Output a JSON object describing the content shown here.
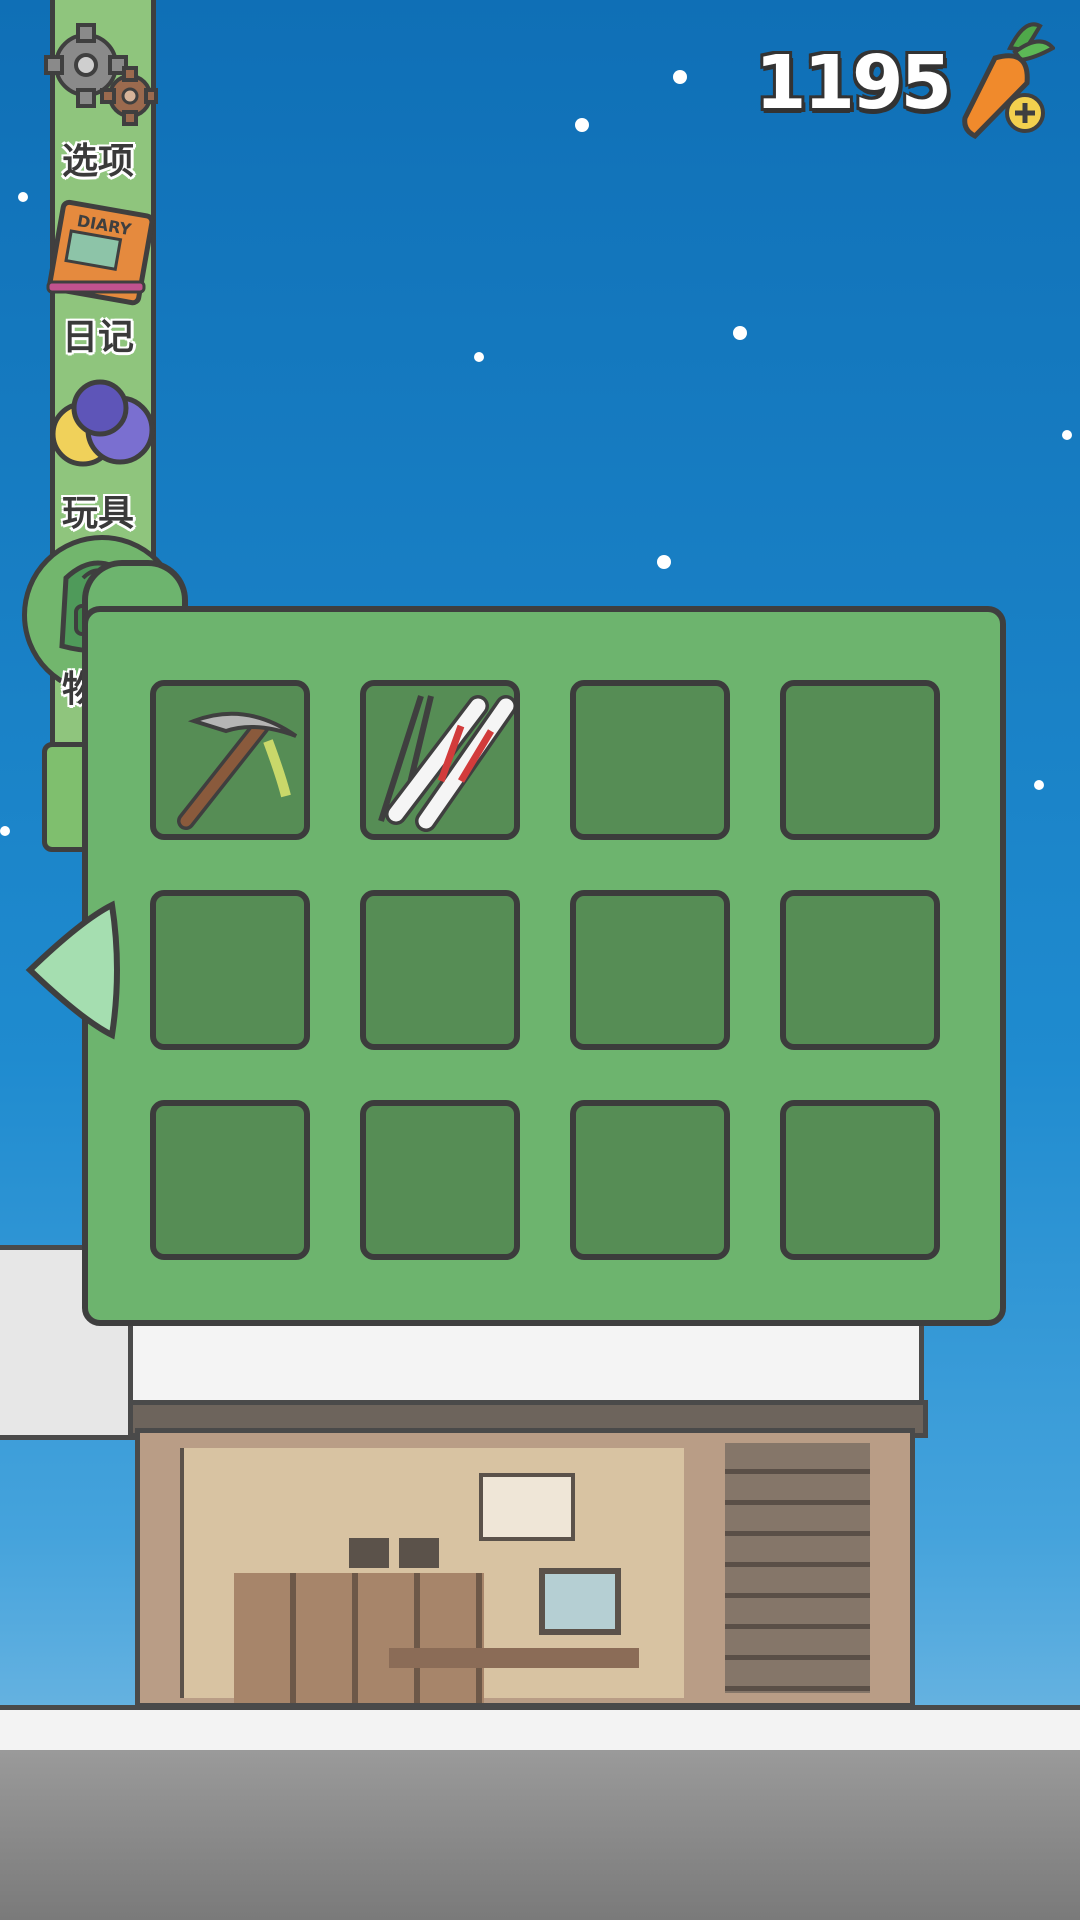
{
  "hud": {
    "carrot_count": "1195"
  },
  "sidebar": {
    "items": [
      {
        "label": "选项",
        "icon": "gear-icon"
      },
      {
        "label": "日记",
        "icon": "diary-icon"
      },
      {
        "label": "玩具",
        "icon": "toys-icon"
      },
      {
        "label": "物品",
        "icon": "backpack-icon"
      }
    ],
    "diary_cover_text": "DIARY"
  },
  "inventory": {
    "slots": [
      {
        "item": "ice-axe"
      },
      {
        "item": "skis-and-poles"
      },
      {
        "item": ""
      },
      {
        "item": ""
      },
      {
        "item": ""
      },
      {
        "item": ""
      },
      {
        "item": ""
      },
      {
        "item": ""
      },
      {
        "item": ""
      },
      {
        "item": ""
      },
      {
        "item": ""
      },
      {
        "item": ""
      }
    ]
  },
  "colors": {
    "panel_green": "#6db46e",
    "slot_green": "#568d55",
    "sky_blue": "#1f8bcf",
    "outline": "#3f3f3f"
  }
}
